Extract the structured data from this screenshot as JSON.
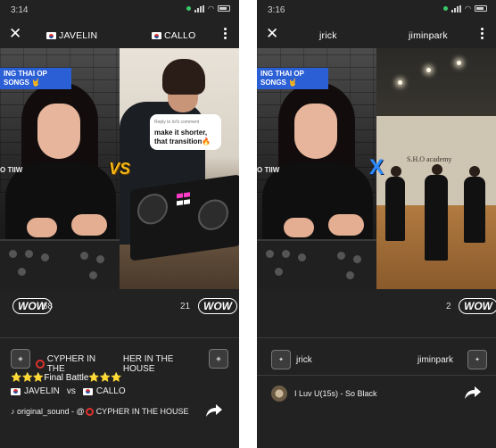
{
  "left": {
    "status": {
      "time": "3:14"
    },
    "header": {
      "player_left": "JAVELIN",
      "player_right": "CALLO"
    },
    "video_left": {
      "banner": "ING THAI OP SONGS 🤘",
      "side_text": "O TIIW"
    },
    "video_right": {
      "comment_reply": "Reply to lol's comment",
      "comment": "make it shorter, that transition🔥"
    },
    "versus": "VS",
    "reactions": {
      "left_label": "WOW",
      "left_count": "68",
      "right_label": "WOW",
      "right_count": "21"
    },
    "info": {
      "channel_left": "CYPHER IN THE",
      "channel_right": "HER IN THE HOUSE",
      "title": "⭐⭐⭐Final Battle⭐⭐⭐",
      "player_left": "JAVELIN",
      "vs_text": "vs",
      "player_right": "CALLO",
      "sound": "♪ original_sound - @",
      "sound_channel": "CYPHER IN THE HOUSE"
    }
  },
  "right": {
    "status": {
      "time": "3:16"
    },
    "header": {
      "player_left": "jrick",
      "player_right": "jiminpark"
    },
    "video_left": {
      "banner": "ING THAI OP SONGS 🤘",
      "side_text": "O TIIW"
    },
    "video_right": {
      "wall_text": "S.H.O academy"
    },
    "versus": "X",
    "reactions": {
      "right_label": "WOW",
      "right_count": "2"
    },
    "info": {
      "player_left": "jrick",
      "player_right": "jiminpark",
      "song": "I Luv U(15s)  - So Black"
    }
  },
  "colors": {
    "background": "#222222",
    "vs_gold": "#f5b816",
    "x_blue": "#2d8bff",
    "banner_blue": "#2b5fd6",
    "ring_red": "#e0312b"
  }
}
